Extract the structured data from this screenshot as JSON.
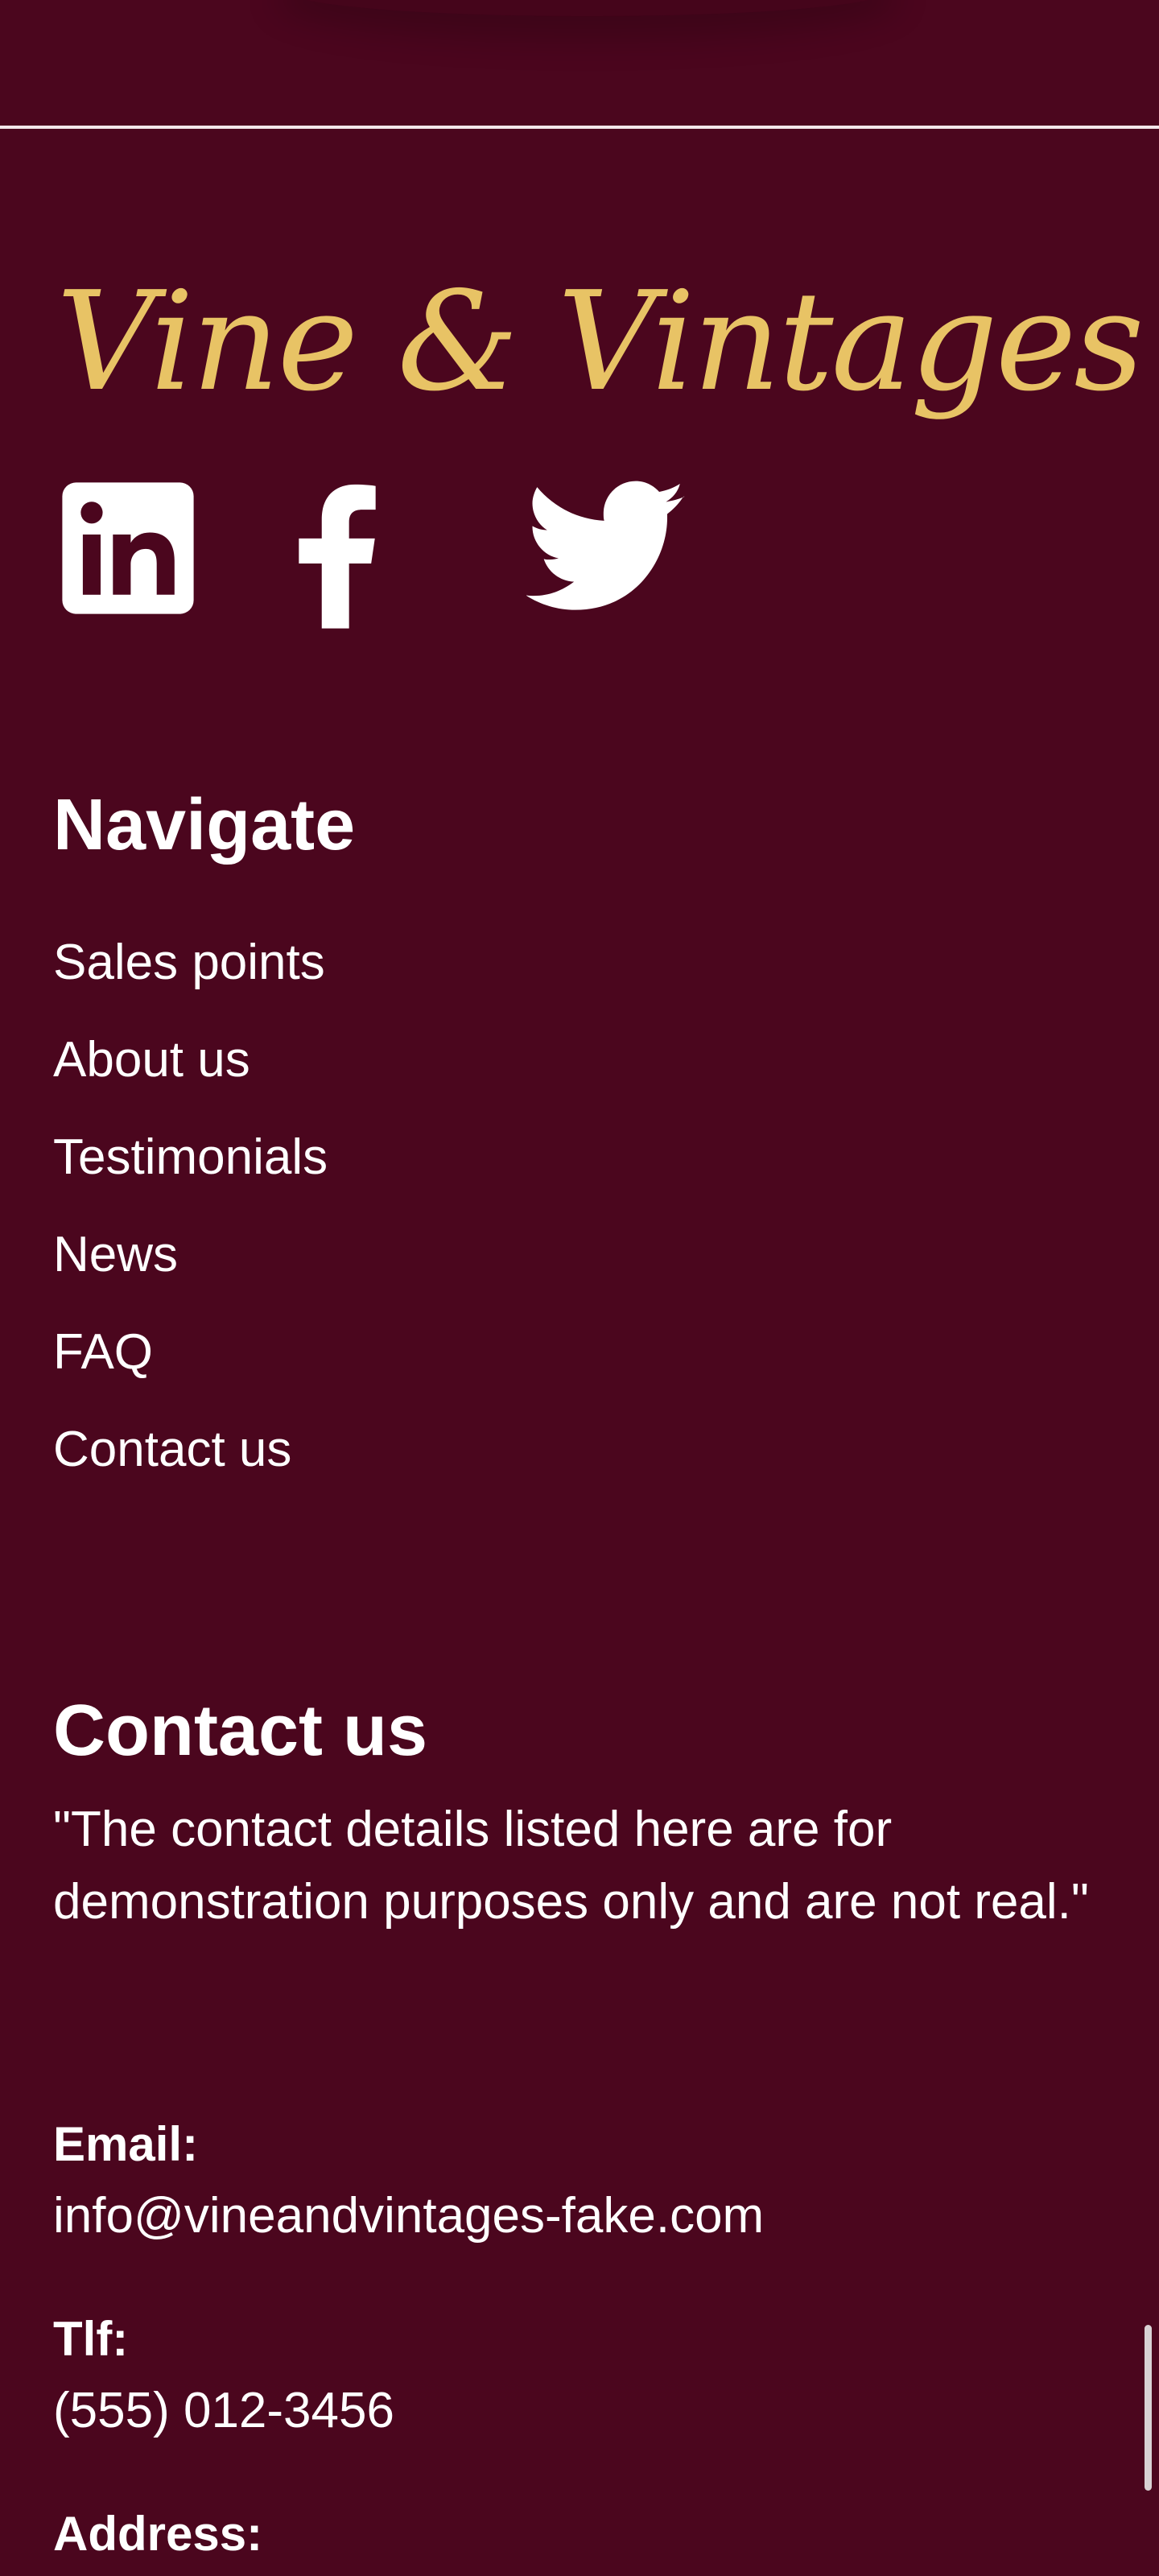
{
  "brand": {
    "logo_text": "Vine & Vintages",
    "colors": {
      "background": "#4b061e",
      "logo": "#e8c365",
      "text": "#ffffff"
    }
  },
  "social": [
    {
      "name": "LinkedIn",
      "icon": "linkedin-icon"
    },
    {
      "name": "Facebook",
      "icon": "facebook-icon"
    },
    {
      "name": "Twitter",
      "icon": "twitter-icon"
    }
  ],
  "navigate": {
    "title": "Navigate",
    "links": [
      "Sales points",
      "About us",
      "Testimonials",
      "News",
      "FAQ",
      "Contact us"
    ]
  },
  "contact": {
    "title": "Contact us",
    "disclaimer": "\"The contact details listed here are for demonstration purposes only and are not real.\"",
    "email_label": "Email:",
    "email_value": "info@vineandvintages-fake.com",
    "phone_label": "Tlf:",
    "phone_value": "(555) 012-3456",
    "address_label": "Address:"
  }
}
